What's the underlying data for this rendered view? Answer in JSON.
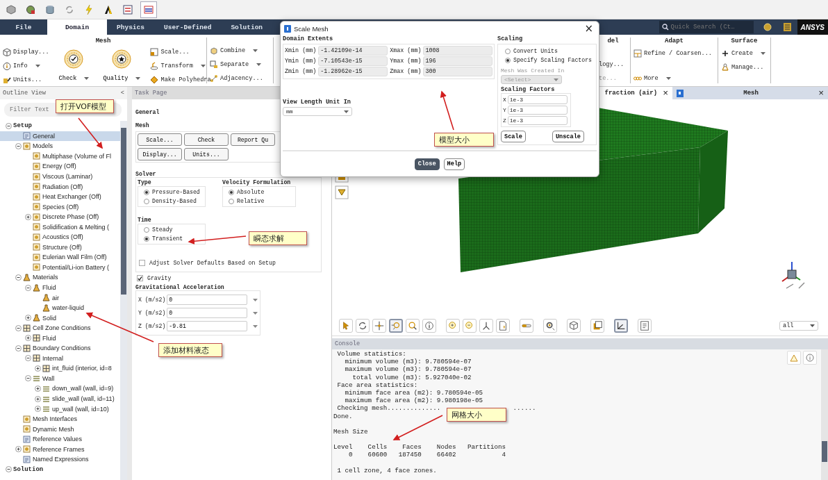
{
  "quick_toolbar": {
    "tools": [
      {
        "selected": false
      },
      {
        "selected": false
      },
      {
        "selected": false
      },
      {
        "selected": false
      },
      {
        "selected": false
      },
      {
        "selected": false
      },
      {
        "selected": false
      },
      {
        "selected": true
      }
    ]
  },
  "ribbon": {
    "tabs": [
      {
        "label": "File",
        "selected": false
      },
      {
        "label": "Domain",
        "selected": true
      },
      {
        "label": "Physics",
        "selected": false
      },
      {
        "label": "User-Defined",
        "selected": false
      },
      {
        "label": "Solution",
        "selected": false
      }
    ],
    "search": {
      "placeholder": "Quick Search (Ct…"
    },
    "logo": "ANSYS",
    "groups": [
      {
        "title": "Mesh",
        "columns": [
          [
            {
              "label": "Display...",
              "kind": "small",
              "dropdown": false
            },
            {
              "label": "Info",
              "kind": "small",
              "dropdown": true
            },
            {
              "label": "Units...",
              "kind": "small",
              "dropdown": false
            }
          ],
          [
            {
              "label": "Check",
              "kind": "large",
              "dropdown": true
            }
          ],
          [
            {
              "label": "Quality",
              "kind": "large",
              "dropdown": true
            }
          ],
          [
            {
              "label": "Scale...",
              "kind": "small",
              "dropdown": false
            },
            {
              "label": "Transform",
              "kind": "small",
              "dropdown": true
            },
            {
              "label": "Make Polyhedra",
              "kind": "small",
              "dropdown": false
            }
          ]
        ]
      },
      {
        "columns": [
          [
            {
              "label": "Combine",
              "kind": "small",
              "dropdown": true
            },
            {
              "label": "Separate",
              "kind": "small",
              "dropdown": true
            },
            {
              "label": "Adjacency...",
              "kind": "small",
              "dropdown": false
            }
          ]
        ]
      },
      {
        "title": "del",
        "columns": [
          [
            {
              "label": "logy...",
              "kind": "bare",
              "dropdown": false,
              "disabled": false
            },
            {
              "label": "te...",
              "kind": "bare",
              "dropdown": false,
              "disabled": true
            }
          ]
        ]
      },
      {
        "title": "Adapt",
        "columns": [
          [
            {
              "label": "Refine / Coarsen...",
              "kind": "small",
              "dropdown": false
            },
            {
              "label": "More",
              "kind": "small",
              "dropdown": true
            }
          ]
        ]
      },
      {
        "title": "Surface",
        "columns": [
          [
            {
              "label": "Create",
              "kind": "small",
              "dropdown": true
            },
            {
              "label": "Manage...",
              "kind": "small",
              "dropdown": false
            }
          ]
        ]
      }
    ]
  },
  "outline": {
    "title": "Outline View",
    "collapse": "<",
    "filter": {
      "placeholder": "Filter Text"
    },
    "tree": [
      {
        "label": "Setup",
        "kind": "section",
        "expanded": true,
        "selected": false,
        "children": [
          {
            "label": "General",
            "kind": "page",
            "selected": true
          },
          {
            "label": "Models",
            "kind": "model",
            "expanded": true,
            "selected": false,
            "children": [
              {
                "label": "Multiphase (Volume of Fl",
                "kind": "model",
                "selected": false
              },
              {
                "label": "Energy (Off)",
                "kind": "model",
                "selected": false
              },
              {
                "label": "Viscous (Laminar)",
                "kind": "model",
                "selected": false
              },
              {
                "label": "Radiation (Off)",
                "kind": "model",
                "selected": false
              },
              {
                "label": "Heat Exchanger (Off)",
                "kind": "model",
                "selected": false
              },
              {
                "label": "Species (Off)",
                "kind": "model",
                "selected": false
              },
              {
                "label": "Discrete Phase (Off)",
                "kind": "model",
                "expanded": false,
                "selected": false
              },
              {
                "label": "Solidification & Melting (",
                "kind": "model",
                "selected": false
              },
              {
                "label": "Acoustics (Off)",
                "kind": "model",
                "selected": false
              },
              {
                "label": "Structure (Off)",
                "kind": "model",
                "selected": false
              },
              {
                "label": "Eulerian Wall Film (Off)",
                "kind": "model",
                "selected": false
              },
              {
                "label": "Potential/Li-ion Battery (",
                "kind": "model",
                "selected": false
              }
            ]
          },
          {
            "label": "Materials",
            "kind": "material",
            "expanded": true,
            "selected": false,
            "children": [
              {
                "label": "Fluid",
                "kind": "material",
                "expanded": true,
                "selected": false,
                "children": [
                  {
                    "label": "air",
                    "kind": "material",
                    "selected": false
                  },
                  {
                    "label": "water-liquid",
                    "kind": "material",
                    "selected": false
                  }
                ]
              },
              {
                "label": "Solid",
                "kind": "material",
                "expanded": false,
                "selected": false
              }
            ]
          },
          {
            "label": "Cell Zone Conditions",
            "kind": "zone",
            "expanded": true,
            "selected": false,
            "children": [
              {
                "label": "Fluid",
                "kind": "zone",
                "expanded": false,
                "selected": false
              }
            ]
          },
          {
            "label": "Boundary Conditions",
            "kind": "zone",
            "expanded": true,
            "selected": false,
            "children": [
              {
                "label": "Internal",
                "kind": "zone",
                "expanded": true,
                "selected": false,
                "children": [
                  {
                    "label": "int_fluid (interior, id=8",
                    "kind": "zone",
                    "expanded": false,
                    "selected": false
                  }
                ]
              },
              {
                "label": "Wall",
                "kind": "wall",
                "expanded": true,
                "selected": false,
                "children": [
                  {
                    "label": "down_wall (wall, id=9)",
                    "kind": "wall",
                    "expanded": false,
                    "selected": false
                  },
                  {
                    "label": "slide_wall (wall, id=11)",
                    "kind": "wall",
                    "expanded": false,
                    "selected": false
                  },
                  {
                    "label": "up_wall (wall, id=10)",
                    "kind": "wall",
                    "expanded": false,
                    "selected": false
                  }
                ]
              }
            ]
          },
          {
            "label": "Mesh Interfaces",
            "kind": "model",
            "selected": false
          },
          {
            "label": "Dynamic Mesh",
            "kind": "model",
            "selected": false
          },
          {
            "label": "Reference Values",
            "kind": "page",
            "selected": false
          },
          {
            "label": "Reference Frames",
            "kind": "model",
            "expanded": false,
            "selected": false
          },
          {
            "label": "Named Expressions",
            "kind": "page",
            "selected": false
          }
        ]
      },
      {
        "label": "Solution",
        "kind": "section",
        "expanded": true,
        "selected": false
      }
    ]
  },
  "task_page": {
    "title": "Task Page",
    "heading": "General",
    "mesh": {
      "title": "Mesh",
      "buttons": [
        "Scale...",
        "Check",
        "Report Qu",
        "Display...",
        "Units..."
      ]
    },
    "solver": {
      "title": "Solver",
      "type": {
        "title": "Type",
        "options": [
          {
            "label": "Pressure-Based",
            "selected": true
          },
          {
            "label": "Density-Based",
            "selected": false
          }
        ]
      },
      "velocity": {
        "title": "Velocity Formulation",
        "options": [
          {
            "label": "Absolute",
            "selected": true
          },
          {
            "label": "Relative",
            "selected": false
          }
        ]
      },
      "time": {
        "title": "Time",
        "options": [
          {
            "label": "Steady",
            "selected": false
          },
          {
            "label": "Transient",
            "selected": true
          }
        ]
      },
      "adjust": {
        "label": "Adjust Solver Defaults Based on Setup",
        "checked": false
      }
    },
    "gravity": {
      "label": "Gravity",
      "checked": true
    },
    "acceleration": {
      "title": "Gravitational Acceleration",
      "fields": [
        {
          "label": "X (m/s2)",
          "value": "0"
        },
        {
          "label": "Y (m/s2)",
          "value": "0"
        },
        {
          "label": "Z (m/s2)",
          "value": "-9.81"
        }
      ]
    }
  },
  "graphics": {
    "tabs": [
      {
        "label": "fraction (air)",
        "selected": false,
        "close": "×"
      },
      {
        "label": "Mesh",
        "selected": true,
        "close": "×"
      }
    ],
    "toolbar": {
      "tools": [
        {
          "selected": false
        },
        {
          "selected": false
        },
        {
          "selected": false
        },
        {
          "selected": true
        },
        {
          "selected": false
        },
        {
          "selected": false
        },
        {
          "selected": false
        },
        {
          "selected": false
        },
        {
          "selected": false
        },
        {
          "selected": false
        },
        {
          "selected": false
        },
        {
          "selected": false
        },
        {
          "selected": false
        },
        {
          "selected": false
        },
        {
          "selected": true
        },
        {
          "selected": false
        }
      ],
      "view": {
        "value": "all"
      }
    }
  },
  "console": {
    "title": "Console",
    "paragraphs": [
      [
        " Volume statistics:",
        "   minimum volume (m3): 9.780594e-07",
        "   maximum volume (m3): 9.780594e-07",
        "     total volume (m3): 5.927040e-02",
        " Face area statistics:",
        "   minimum face area (m2): 9.780594e-05",
        "   maximum face area (m2): 9.980198e-05",
        [
          " Checking mesh..............",
          "......"
        ],
        "Done."
      ],
      [
        "Mesh Size"
      ],
      [
        "Level    Cells    Faces    Nodes   Partitions",
        "    0    60600   187450    66402            4"
      ],
      [
        " 1 cell zone, 4 face zones."
      ]
    ]
  },
  "dialog": {
    "title": "Scale Mesh",
    "close": "×",
    "extents": {
      "title": "Domain Extents",
      "fields": [
        {
          "label": "Xmin (mm)",
          "value": "-1.42109e-14"
        },
        {
          "label": "Xmax (mm)",
          "value": "1008"
        },
        {
          "label": "Ymin (mm)",
          "value": "-7.10543e-15"
        },
        {
          "label": "Ymax (mm)",
          "value": "196"
        },
        {
          "label": "Zmin (mm)",
          "value": "-1.28962e-15"
        },
        {
          "label": "Zmax (mm)",
          "value": "300"
        }
      ]
    },
    "view_unit": {
      "label": "View Length Unit In",
      "value": "mm"
    },
    "scaling": {
      "title": "Scaling",
      "options": [
        {
          "label": "Convert Units",
          "selected": false
        },
        {
          "label": "Specify Scaling Factors",
          "selected": true
        }
      ],
      "created_in": {
        "label": "Mesh Was Created In",
        "value": "<Select>",
        "disabled": true
      },
      "factors": {
        "title": "Scaling Factors",
        "fields": [
          {
            "label": "X",
            "value": "1e-3"
          },
          {
            "label": "Y",
            "value": "1e-3"
          },
          {
            "label": "Z",
            "value": "1e-3"
          }
        ]
      },
      "buttons": [
        "Scale",
        "Unscale"
      ]
    },
    "buttons": [
      {
        "label": "Close",
        "primary": true
      },
      {
        "label": "Help",
        "primary": false
      }
    ]
  },
  "callouts": [
    {
      "text": "打开VOF模型"
    },
    {
      "text": "瞬态求解"
    },
    {
      "text": "模型大小"
    },
    {
      "text": "添加材料液态"
    },
    {
      "text": "网格大小"
    }
  ]
}
